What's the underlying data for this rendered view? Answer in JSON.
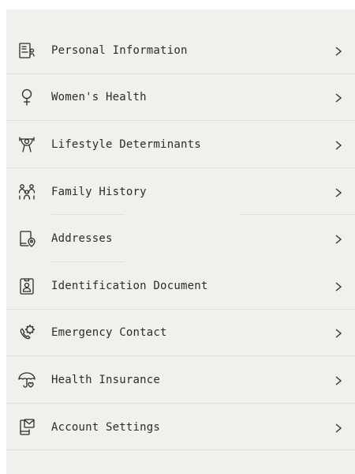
{
  "menu": {
    "items": [
      {
        "label": "Personal Information",
        "icon": "id-card-icon"
      },
      {
        "label": "Women's Health",
        "icon": "female-symbol-icon"
      },
      {
        "label": "Lifestyle Determinants",
        "icon": "lifestyle-icon"
      },
      {
        "label": "Family History",
        "icon": "family-icon"
      },
      {
        "label": "Addresses",
        "icon": "address-location-icon"
      },
      {
        "label": "Identification Document",
        "icon": "id-badge-icon"
      },
      {
        "label": "Emergency Contact",
        "icon": "emergency-phone-icon"
      },
      {
        "label": "Health Insurance",
        "icon": "umbrella-heart-icon"
      },
      {
        "label": "Account Settings",
        "icon": "account-settings-icon"
      }
    ],
    "chevron_icon": "chevron-right-icon"
  }
}
